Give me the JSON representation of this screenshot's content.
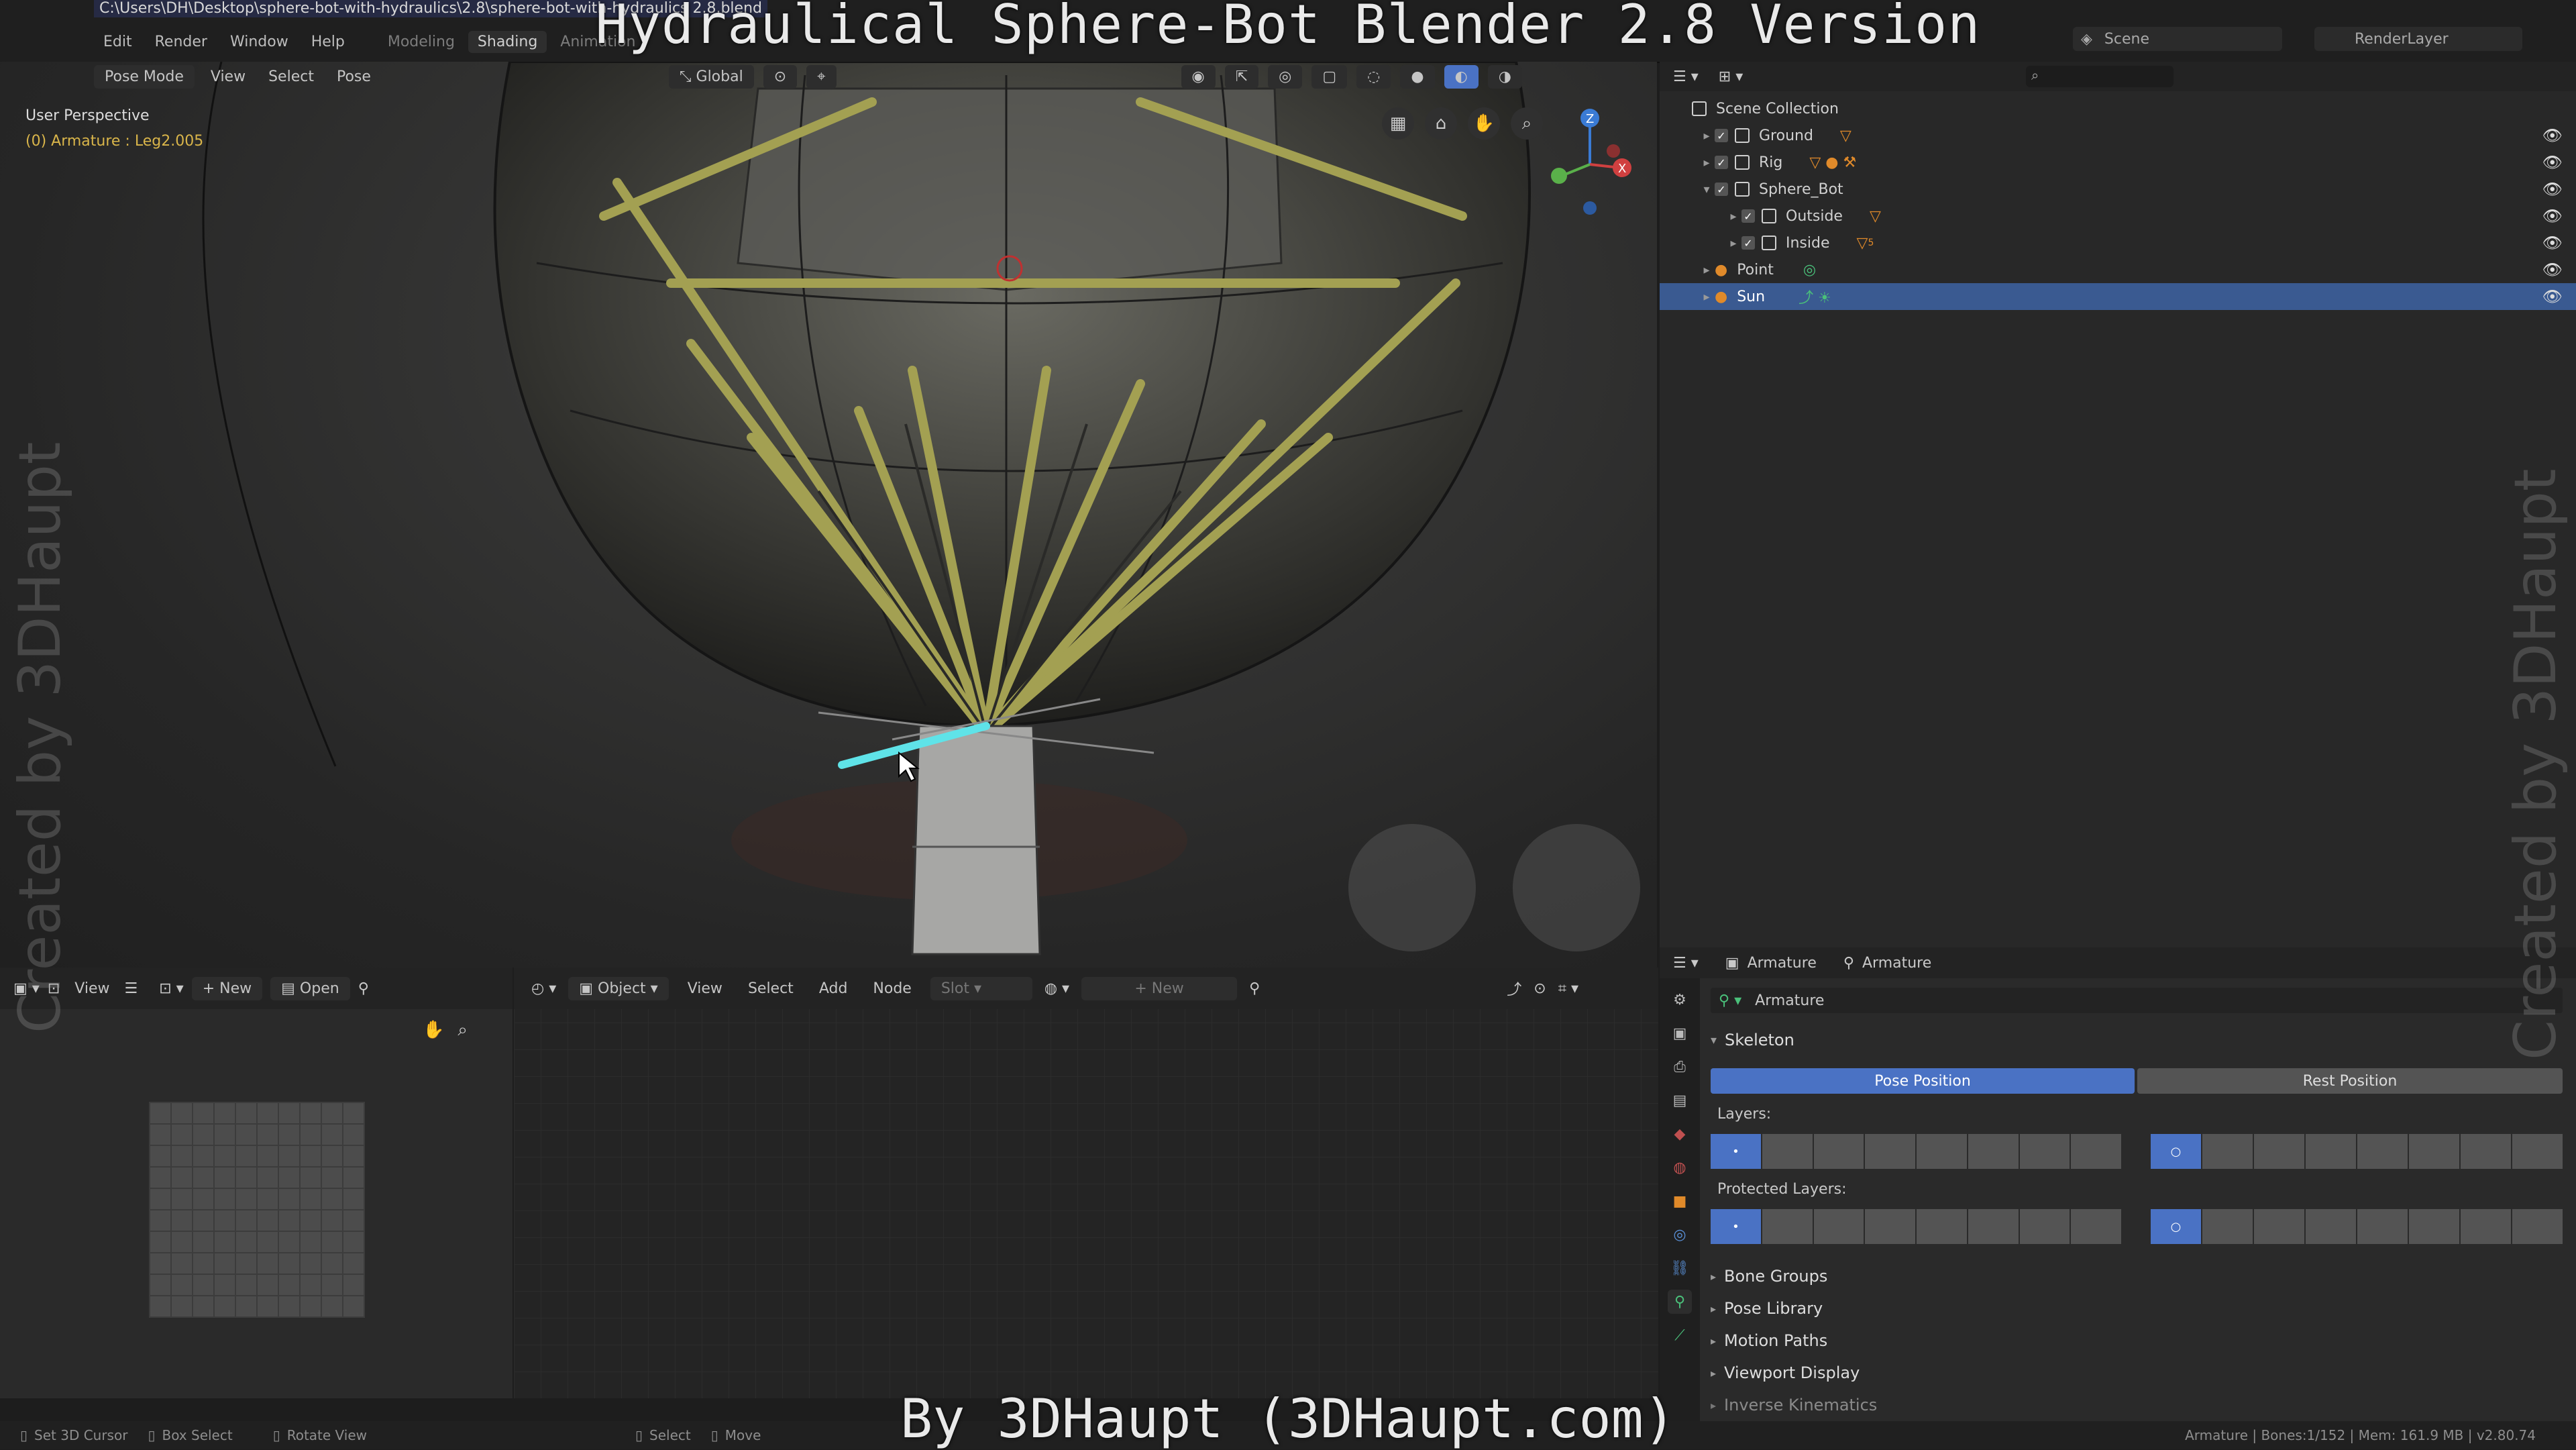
{
  "window": {
    "file_path": "C:\\Users\\DH\\Desktop\\sphere-bot-with-hydraulics\\2.8\\sphere-bot-with-hydraulics 2.8.blend",
    "menus": [
      "Edit",
      "Render",
      "Window",
      "Help"
    ],
    "workspaces": [
      "Modeling",
      "Shading",
      "Animation"
    ],
    "active_workspace": "Shading",
    "scene": "Scene",
    "render_layer": "RenderLayer"
  },
  "overlays": {
    "title": "Hydraulical Sphere-Bot Blender 2.8 Version",
    "credit": "By 3DHaupt (3DHaupt.com)",
    "watermark": "Created by 3DHaupt"
  },
  "viewport": {
    "mode": "Pose Mode",
    "menu_view": "View",
    "menu_select": "Select",
    "menu_pose": "Pose",
    "orientation": "Global",
    "info_perspective": "User Perspective",
    "info_object": "(0) Armature : Leg2.005",
    "gizmo_axis_z": "Z",
    "gizmo_axis_x": "X"
  },
  "outliner": {
    "root": "Scene Collection",
    "items": [
      {
        "label": "Ground",
        "level": 1,
        "kind": "collection",
        "selected": false
      },
      {
        "label": "Rig",
        "level": 1,
        "kind": "collection",
        "selected": false
      },
      {
        "label": "Sphere_Bot",
        "level": 1,
        "kind": "collection",
        "selected": false
      },
      {
        "label": "Outside",
        "level": 2,
        "kind": "collection",
        "selected": false
      },
      {
        "label": "Inside",
        "level": 2,
        "kind": "collection",
        "selected": false
      },
      {
        "label": "Point",
        "level": 1,
        "kind": "light",
        "selected": false
      },
      {
        "label": "Sun",
        "level": 1,
        "kind": "light",
        "selected": true
      }
    ],
    "inside_badge": "5"
  },
  "image_editor": {
    "view": "View",
    "new": "New",
    "open": "Open"
  },
  "node_editor": {
    "object": "Object",
    "view": "View",
    "select": "Select",
    "add": "Add",
    "node": "Node",
    "slot": "Slot",
    "new": "New"
  },
  "properties": {
    "breadcrumb_1": "Armature",
    "breadcrumb_2": "Armature",
    "data_name": "Armature",
    "skeleton_label": "Skeleton",
    "pose_position": "Pose Position",
    "rest_position": "Rest Position",
    "layers_label": "Layers:",
    "protected_layers_label": "Protected Layers:",
    "sections": [
      "Bone Groups",
      "Pose Library",
      "Motion Paths",
      "Viewport Display",
      "Inverse Kinematics"
    ]
  },
  "statusbar": {
    "set_cursor": "Set 3D Cursor",
    "box_select": "Box Select",
    "rotate_view": "Rotate View",
    "select": "Select",
    "move": "Move",
    "stats": "Armature | Bones:1/152 | Mem: 161.9 MB | v2.80.74"
  },
  "colors": {
    "accent": "#4a72c4",
    "selection": "#3a5a91",
    "mode_text": "#d9b54a",
    "bone_yellow": "#a3a052",
    "active_bone": "#5fe3e8"
  }
}
